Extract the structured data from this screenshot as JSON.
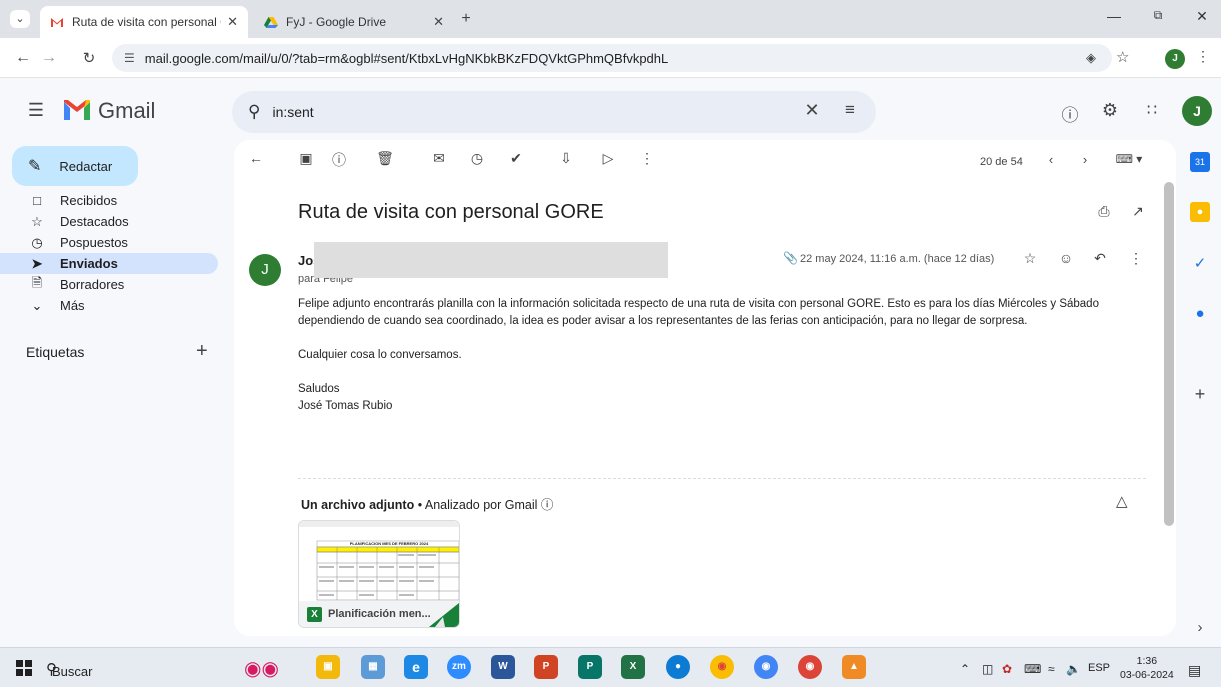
{
  "browser": {
    "tabs": [
      {
        "title": "Ruta de visita con personal GORE"
      },
      {
        "title": "FyJ - Google Drive"
      }
    ],
    "url_display": "mail.google.com/mail/u/0/?tab=rm&ogbl#sent/KtbxLvHgNKbkBKzFDQVktGPhmQBfvkpdhL",
    "profile_initial": "J"
  },
  "gmail": {
    "app_name": "Gmail",
    "search_value": "in:sent",
    "account_initial": "J",
    "compose_label": "Redactar",
    "nav": [
      {
        "label": "Recibidos",
        "icon": "inbox-icon"
      },
      {
        "label": "Destacados",
        "icon": "star-icon"
      },
      {
        "label": "Pospuestos",
        "icon": "clock-icon"
      },
      {
        "label": "Enviados",
        "icon": "send-icon",
        "active": true
      },
      {
        "label": "Borradores",
        "icon": "draft-icon"
      },
      {
        "label": "Más",
        "icon": "chevron-down-icon"
      }
    ],
    "labels_title": "Etiquetas",
    "pager": "20 de 54"
  },
  "message": {
    "subject": "Ruta de visita con personal GORE",
    "sender_initial": "J",
    "sender_name": "Jos",
    "recipient": "para Felipe",
    "date": "22 may 2024, 11:16 a.m. (hace 12 días)",
    "body": [
      "Felipe adjunto encontrarás planilla con la información solicitada respecto de una ruta de visita con personal GORE. Esto es para los días Miércoles y Sábado dependiendo de cuando sea coordinado, la idea es poder avisar a los representantes de las ferias con anticipación, para no llegar de sorpresa.",
      "Cualquier cosa lo conversamos.",
      "Saludos\nJosé Tomas Rubio"
    ],
    "attachment_header": "Un archivo adjunto",
    "attachment_scan": "Analizado por Gmail",
    "attachment_name": "Planificación men...",
    "attachment_preview_title": "PLANIFICACION MES DE FEBRERO 2024"
  },
  "taskbar": {
    "search_label": "Buscar",
    "language": "ESP",
    "time": "1:36",
    "date": "03-06-2024"
  },
  "colors": {
    "compose_bg": "#c2e7ff",
    "active_nav_bg": "#d3e3fd",
    "avatar_green": "#2f7d32",
    "excel_green": "#188038"
  }
}
